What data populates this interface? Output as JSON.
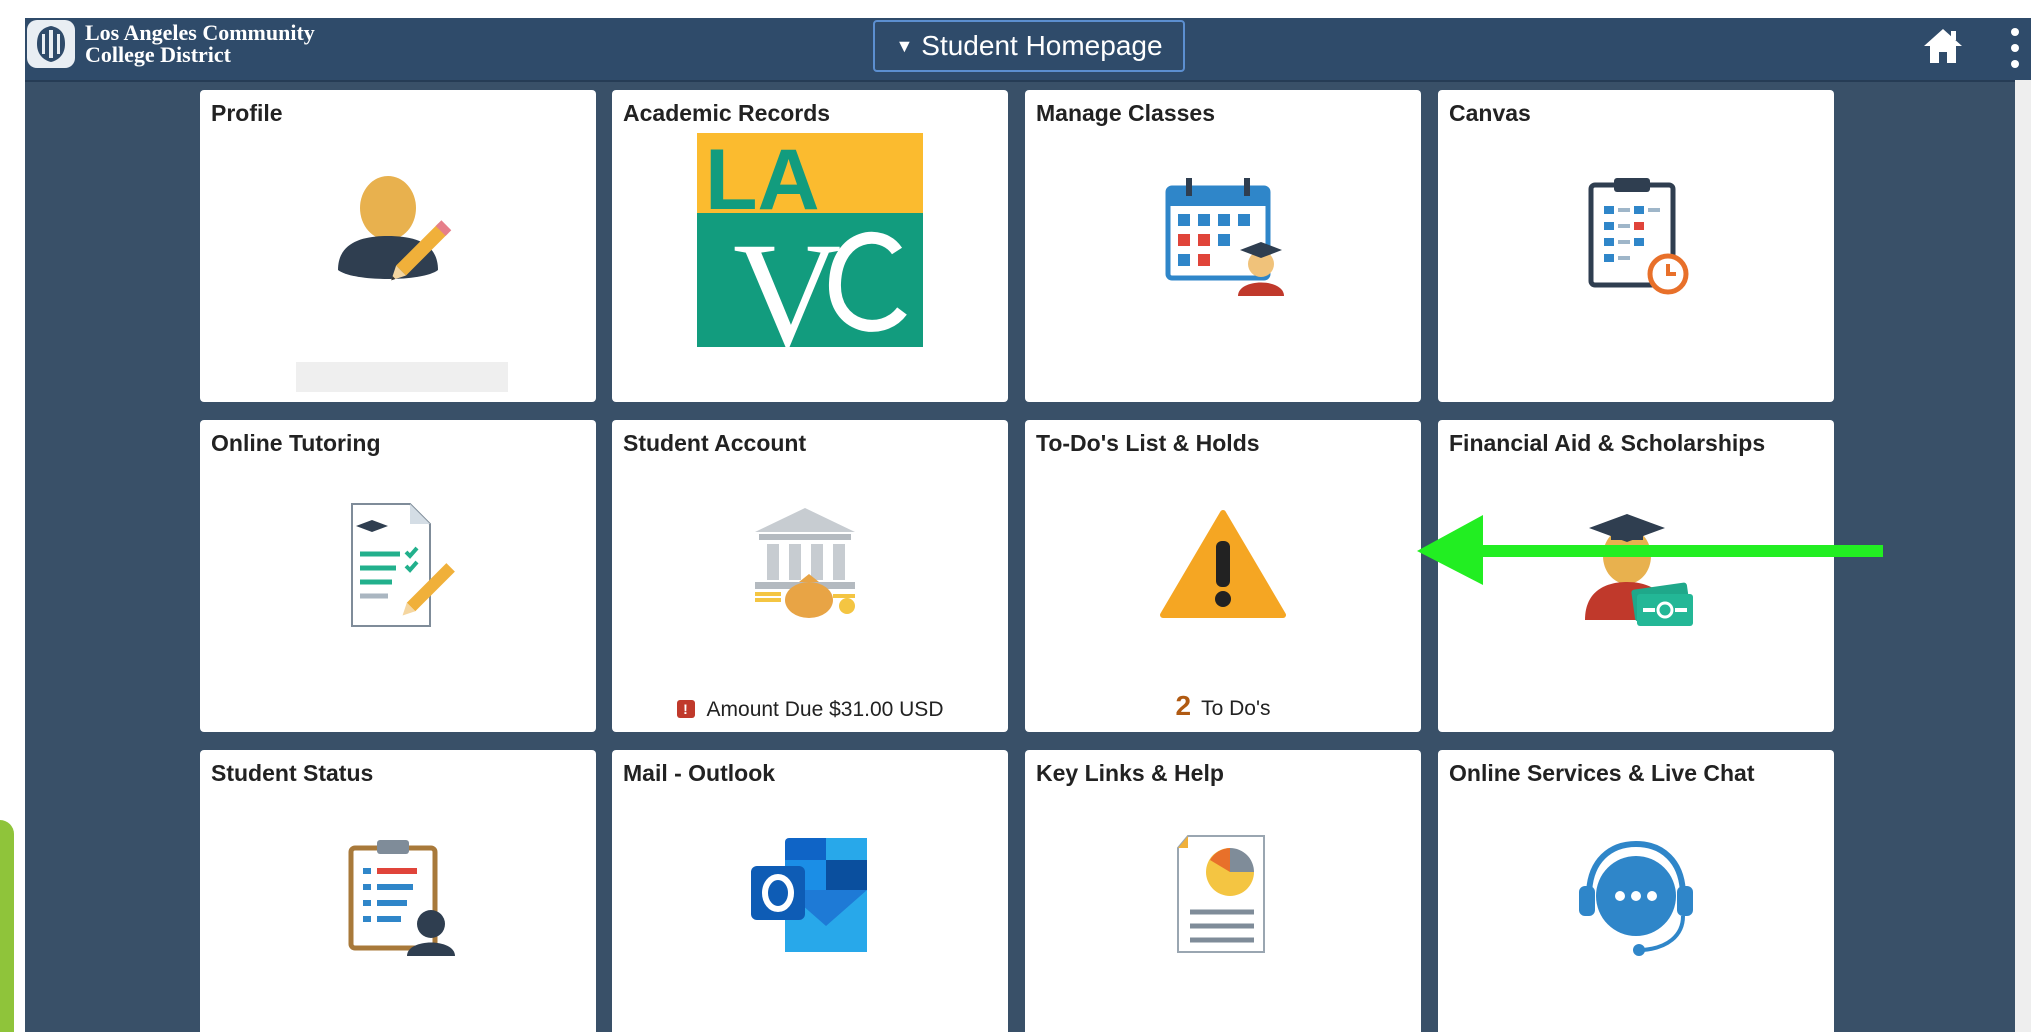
{
  "header": {
    "logo_line1": "Los Angeles Community",
    "logo_line2": "College District",
    "homepage_label": "Student Homepage"
  },
  "tiles": [
    {
      "title": "Profile",
      "icon": "profile-icon"
    },
    {
      "title": "Academic Records",
      "icon": "lavc-logo"
    },
    {
      "title": "Manage Classes",
      "icon": "calendar-student-icon"
    },
    {
      "title": "Canvas",
      "icon": "clipboard-clock-icon"
    },
    {
      "title": "Online Tutoring",
      "icon": "document-checklist-icon"
    },
    {
      "title": "Student Account",
      "icon": "bank-money-icon",
      "footer": "Amount Due $31.00 USD",
      "badge": "!"
    },
    {
      "title": "To-Do's List & Holds",
      "icon": "warning-icon",
      "footer_count": "2",
      "footer": "To Do's"
    },
    {
      "title": "Financial Aid & Scholarships",
      "icon": "graduate-cash-icon"
    },
    {
      "title": "Student Status",
      "icon": "clipboard-person-icon"
    },
    {
      "title": "Mail - Outlook",
      "icon": "outlook-icon"
    },
    {
      "title": "Key Links & Help",
      "icon": "report-pie-icon"
    },
    {
      "title": "Online Services & Live Chat",
      "icon": "headset-chat-icon"
    }
  ],
  "annotation": {
    "arrow_color": "#22ee22"
  },
  "colors": {
    "background": "#395068",
    "topbar": "#2f4b6a",
    "tile": "#ffffff"
  }
}
